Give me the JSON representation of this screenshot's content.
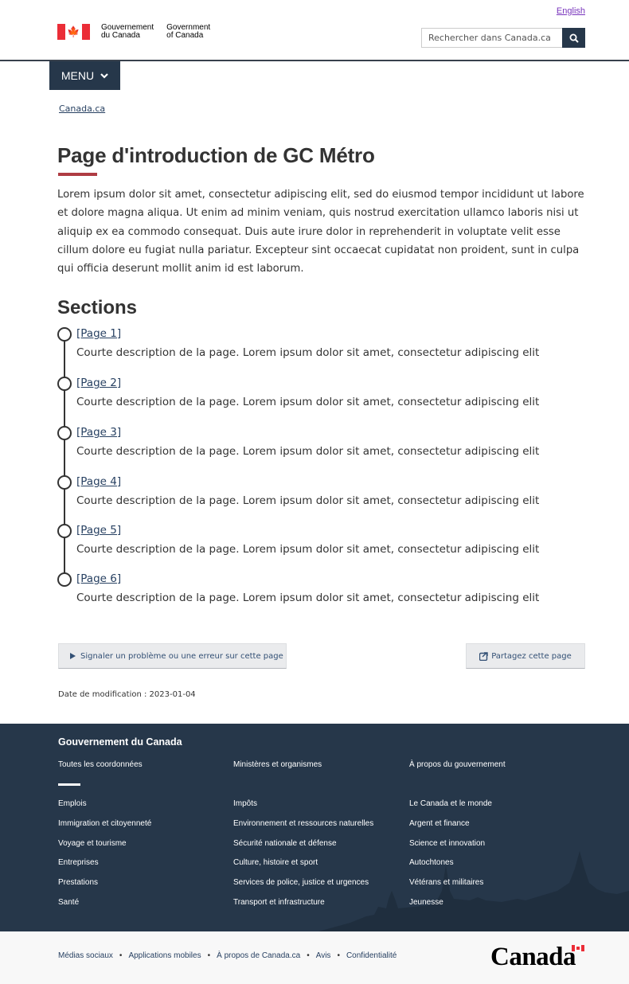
{
  "header": {
    "lang_link": "English",
    "signature_fr": [
      "Gouvernement",
      "du Canada"
    ],
    "signature_en": [
      "Government",
      "of Canada"
    ],
    "search_placeholder": "Rechercher dans Canada.ca",
    "search_icon": "search-icon",
    "menu_label": "MENU"
  },
  "breadcrumb": {
    "items": [
      "Canada.ca"
    ]
  },
  "main": {
    "title": "Page d'introduction de GC Métro",
    "intro": "Lorem ipsum dolor sit amet, consectetur adipiscing elit, sed do eiusmod tempor incididunt ut labore et dolore magna aliqua. Ut enim ad minim veniam, quis nostrud exercitation ullamco laboris nisi ut aliquip ex ea commodo consequat. Duis aute irure dolor in reprehenderit in voluptate velit esse cillum dolore eu fugiat nulla pariatur. Excepteur sint occaecat cupidatat non proident, sunt in culpa qui officia deserunt mollit anim id est laborum.",
    "sections_heading": "Sections",
    "sections": [
      {
        "link": "[Page 1]",
        "desc": "Courte description de la page. Lorem ipsum dolor sit amet, consectetur adipiscing elit"
      },
      {
        "link": "[Page 2]",
        "desc": "Courte description de la page. Lorem ipsum dolor sit amet, consectetur adipiscing elit"
      },
      {
        "link": "[Page 3]",
        "desc": "Courte description de la page. Lorem ipsum dolor sit amet, consectetur adipiscing elit"
      },
      {
        "link": "[Page 4]",
        "desc": "Courte description de la page. Lorem ipsum dolor sit amet, consectetur adipiscing elit"
      },
      {
        "link": "[Page 5]",
        "desc": "Courte description de la page. Lorem ipsum dolor sit amet, consectetur adipiscing elit"
      },
      {
        "link": "[Page 6]",
        "desc": "Courte description de la page. Lorem ipsum dolor sit amet, consectetur adipiscing elit"
      }
    ],
    "report_button": "Signaler un problème ou une erreur sur cette page",
    "share_button": "Partagez cette page",
    "date_modified": "Date de modification : 2023-01-04"
  },
  "footer": {
    "heading": "Gouvernement du Canada",
    "top_links": [
      "Toutes les coordonnées",
      "Ministères et organismes",
      "À propos du gouvernement"
    ],
    "col1": [
      "Emplois",
      "Immigration et citoyenneté",
      "Voyage et tourisme",
      "Entreprises",
      "Prestations",
      "Santé"
    ],
    "col2": [
      "Impôts",
      "Environnement et ressources naturelles",
      "Sécurité nationale et défense",
      "Culture, histoire et sport",
      "Services de police, justice et urgences",
      "Transport et infrastructure"
    ],
    "col3": [
      "Le Canada et le monde",
      "Argent et finance",
      "Science et innovation",
      "Autochtones",
      "Vétérans et militaires",
      "Jeunesse"
    ],
    "bottom_links": [
      "Médias sociaux",
      "Applications mobiles",
      "À propos de Canada.ca",
      "Avis",
      "Confidentialité"
    ],
    "separator": "•",
    "wordmark": "Canada"
  },
  "colors": {
    "primary_dark": "#26374a",
    "flag_red": "#eb2d37",
    "title_underline": "#af3c43",
    "link": "#284162",
    "visited_link": "#7834bc"
  }
}
